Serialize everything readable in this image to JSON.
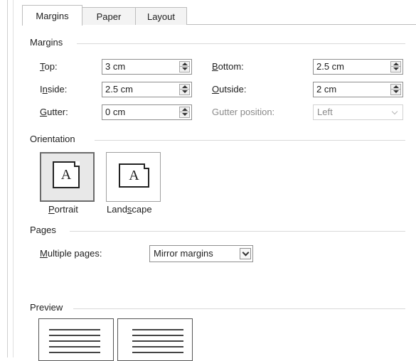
{
  "tabs": [
    "Margins",
    "Paper",
    "Layout"
  ],
  "margins": {
    "group_title": "Margins",
    "top": {
      "label_underline": "T",
      "label_rest": "op:",
      "value": "3 cm"
    },
    "bottom": {
      "label_underline": "B",
      "label_rest": "ottom:",
      "value": "2.5 cm"
    },
    "inside": {
      "label_before": "I",
      "label_underline": "n",
      "label_rest": "side:",
      "value": "2.5 cm"
    },
    "outside": {
      "label_underline": "O",
      "label_rest": "utside:",
      "value": "2 cm"
    },
    "gutter": {
      "label_underline": "G",
      "label_rest": "utter:",
      "value": "0 cm"
    },
    "gutter_position": {
      "label": "Gutter position:",
      "value": "Left",
      "disabled": true
    }
  },
  "orientation": {
    "group_title": "Orientation",
    "portrait": {
      "label_underline": "P",
      "label_rest": "ortrait",
      "glyph": "A",
      "selected": true
    },
    "landscape": {
      "label_before": "Land",
      "label_underline": "s",
      "label_rest": "cape",
      "glyph": "A",
      "selected": false
    }
  },
  "pages": {
    "group_title": "Pages",
    "multiple_pages": {
      "label_underline": "M",
      "label_rest": "ultiple pages:",
      "value": "Mirror margins"
    }
  },
  "preview": {
    "group_title": "Preview"
  },
  "icons": {
    "spin": "spin-arrows-icon",
    "dropdown": "chevron-down-icon",
    "portrait": "portrait-page-icon",
    "landscape": "landscape-page-icon"
  }
}
